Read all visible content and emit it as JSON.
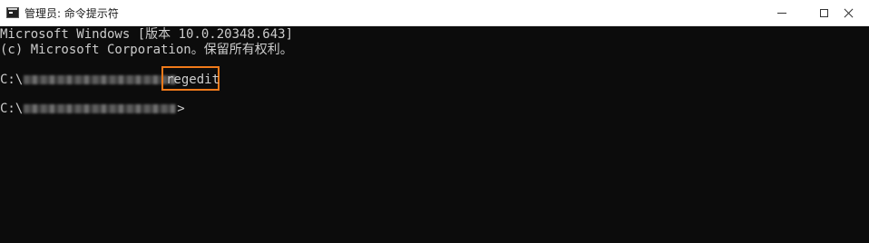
{
  "window": {
    "title": "管理员: 命令提示符",
    "app_icon": "cmd-icon",
    "controls": {
      "minimize": "minimize-icon",
      "maximize": "maximize-icon",
      "close": "close-icon"
    }
  },
  "console": {
    "lines": [
      "Microsoft Windows [版本 10.0.20348.643]",
      "(c) Microsoft Corporation。保留所有权利。"
    ],
    "prompt_prefix": "C:\\",
    "prompt_suffix": ">",
    "command": "regedit",
    "highlight_color": "#f07a1a",
    "background_color": "#0c0c0c",
    "text_color": "#cccccc"
  }
}
